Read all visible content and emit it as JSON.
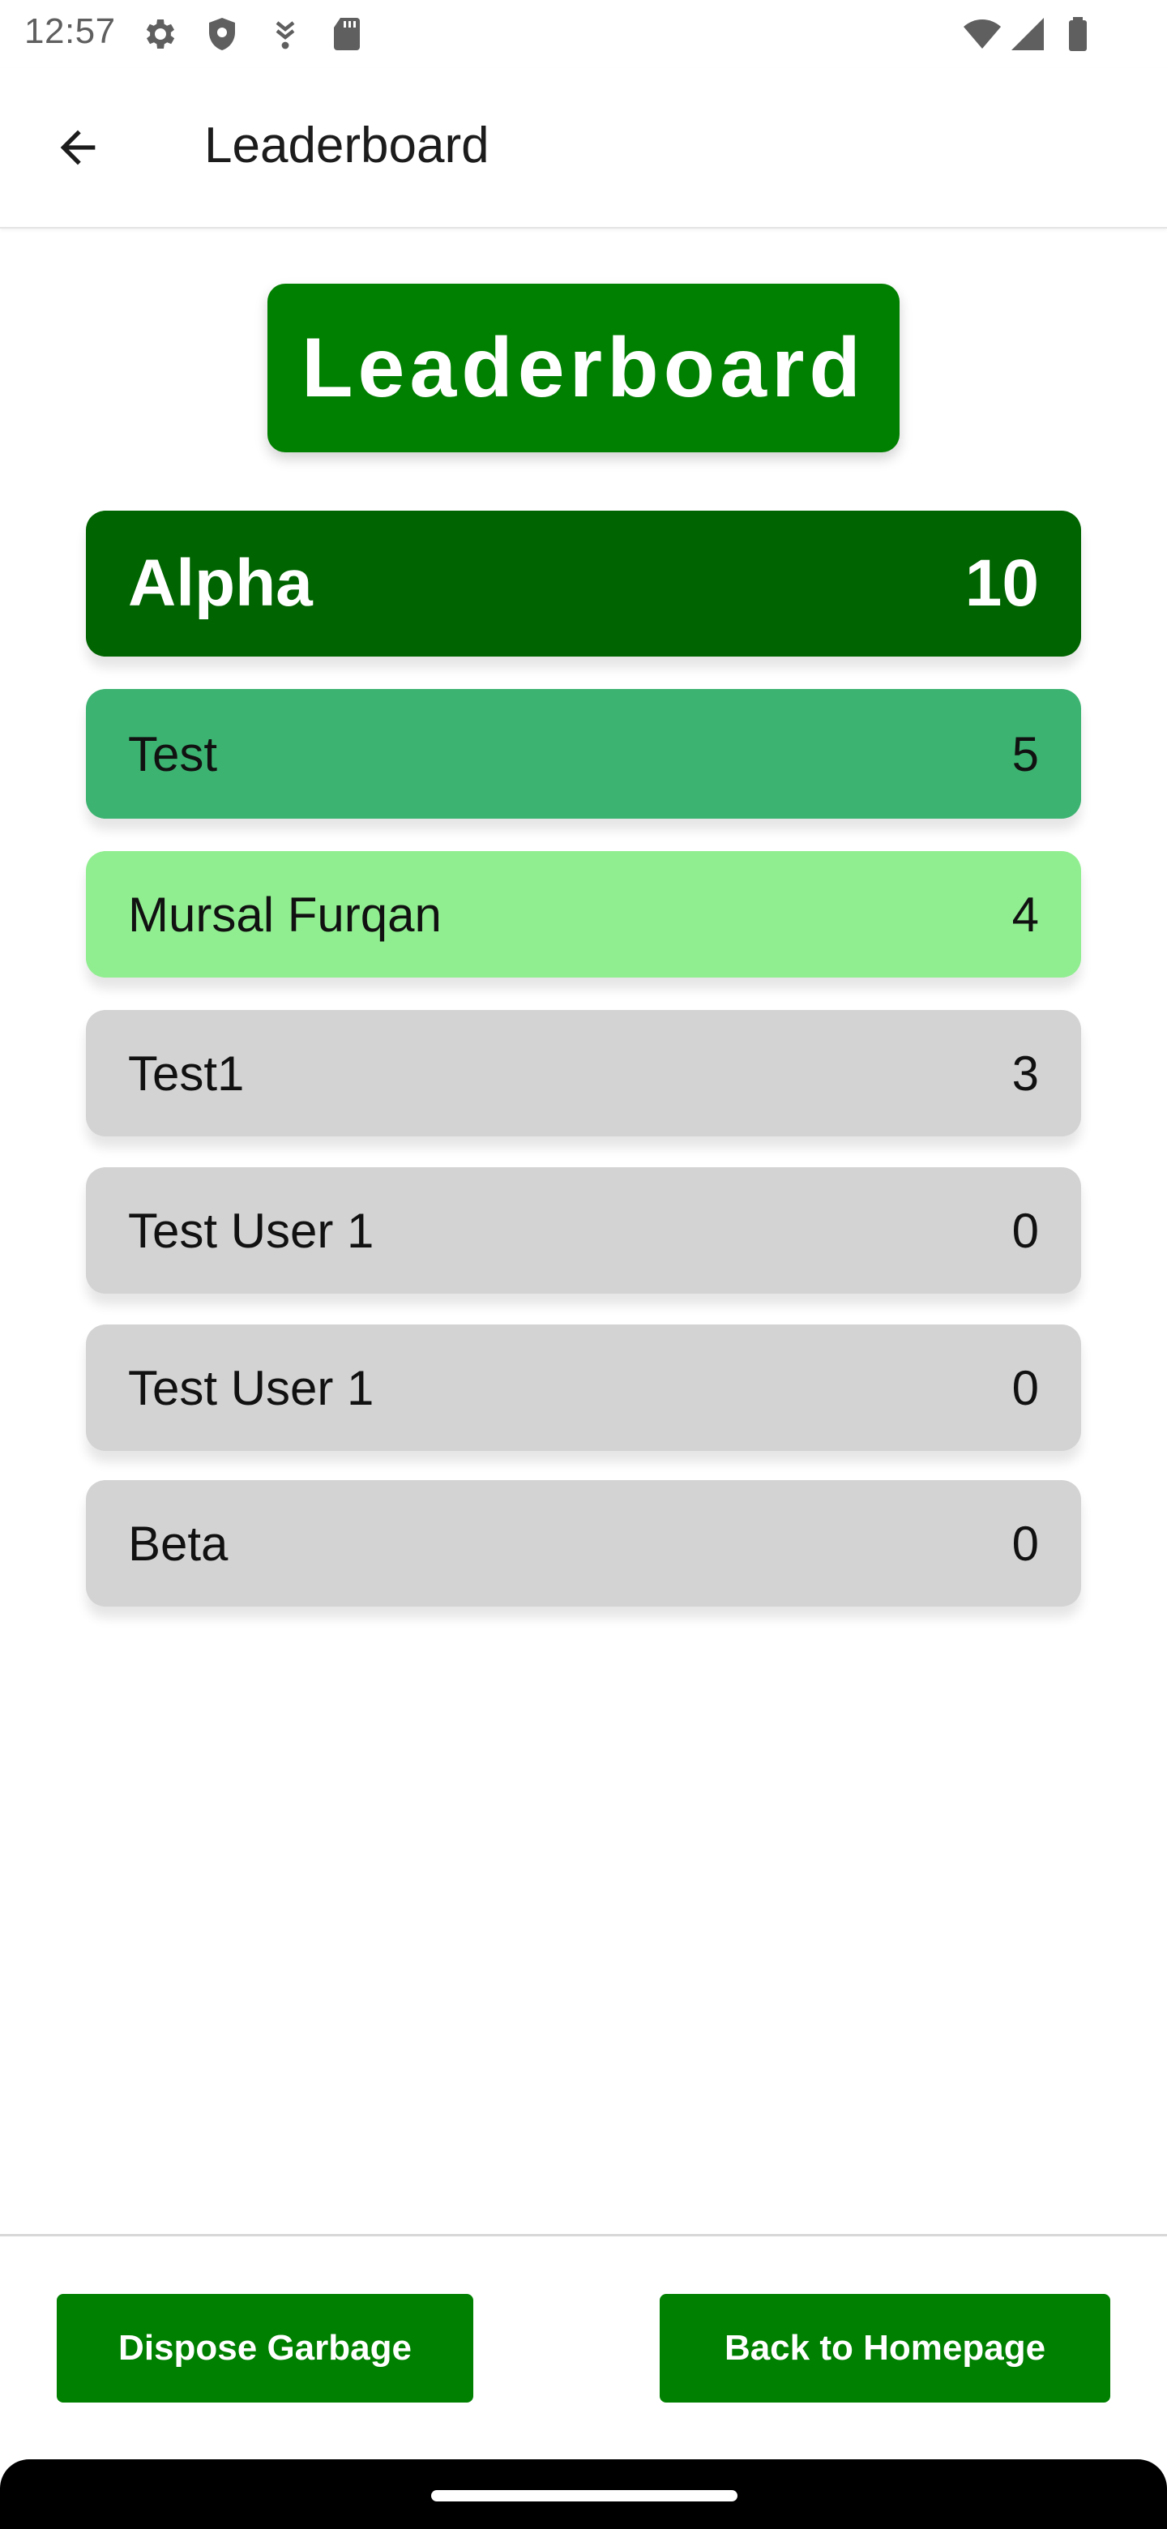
{
  "status_bar": {
    "time": "12:57",
    "icons": [
      "settings-icon",
      "shield-icon",
      "download-icon",
      "sd-card-icon",
      "wifi-icon",
      "signal-icon",
      "battery-icon"
    ]
  },
  "app_bar": {
    "back_icon": "arrow-back-icon",
    "title": "Leaderboard"
  },
  "header": {
    "title": "Leaderboard",
    "color": "#008000"
  },
  "leaderboard": {
    "entries": [
      {
        "name": "Alpha",
        "score": "10",
        "color": "#006400"
      },
      {
        "name": "Test",
        "score": "5",
        "color": "#3cb371"
      },
      {
        "name": "Mursal Furqan",
        "score": "4",
        "color": "#90ee90"
      },
      {
        "name": "Test1",
        "score": "3",
        "color": "#d3d3d3"
      },
      {
        "name": "Test User 1",
        "score": "0",
        "color": "#d3d3d3"
      },
      {
        "name": "Test User 1",
        "score": "0",
        "color": "#d3d3d3"
      },
      {
        "name": "Beta",
        "score": "0",
        "color": "#d3d3d3"
      }
    ]
  },
  "actions": {
    "dispose_label": "Dispose Garbage",
    "home_label": "Back to Homepage",
    "color": "#008000"
  }
}
